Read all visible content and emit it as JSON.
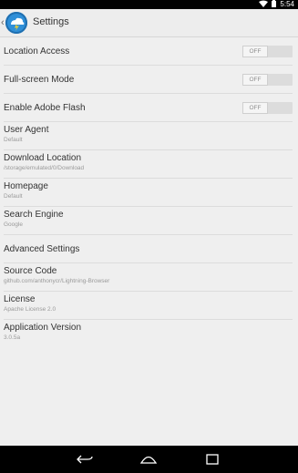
{
  "status_bar": {
    "time": "5:54"
  },
  "app_bar": {
    "title": "Settings"
  },
  "settings": [
    {
      "title": "Location Access",
      "toggle": "OFF"
    },
    {
      "title": "Full-screen Mode",
      "toggle": "OFF"
    },
    {
      "title": "Enable Adobe Flash",
      "toggle": "OFF"
    },
    {
      "title": "User Agent",
      "subtitle": "Default"
    },
    {
      "title": "Download Location",
      "subtitle": "/storage/emulated/0/Download"
    },
    {
      "title": "Homepage",
      "subtitle": "Default"
    },
    {
      "title": "Search Engine",
      "subtitle": "Google"
    },
    {
      "title": "Advanced Settings"
    },
    {
      "title": "Source Code",
      "subtitle": "github.com/anthonycr/Lightning-Browser"
    },
    {
      "title": "License",
      "subtitle": "Apache License 2.0"
    },
    {
      "title": "Application Version",
      "subtitle": "3.0.5a"
    }
  ]
}
